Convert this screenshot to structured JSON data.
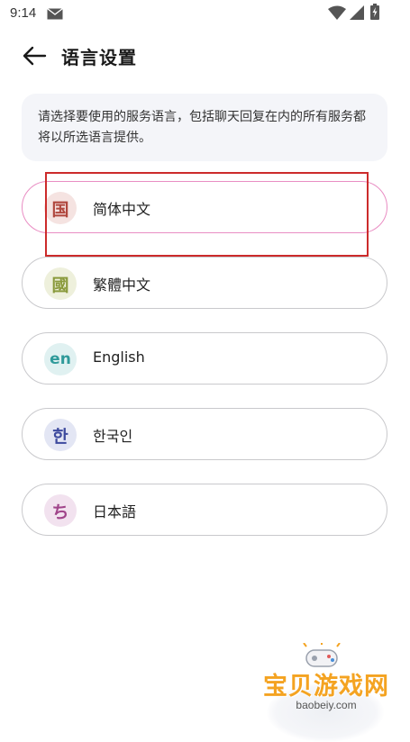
{
  "status_bar": {
    "time": "9:14",
    "icons": [
      "mail-icon",
      "wifi-icon",
      "signal-icon",
      "battery-charging-icon"
    ]
  },
  "header": {
    "back_icon": "arrow-left-icon",
    "title": "语言设置"
  },
  "notice": {
    "text": "请选择要使用的服务语言，包括聊天回复在内的所有服务都将以所选语言提供。"
  },
  "languages": [
    {
      "icon_text": "国",
      "label": "简体中文",
      "selected": true,
      "icon_bg": "#f5e3e1",
      "icon_color": "#b0473e"
    },
    {
      "icon_text": "國",
      "label": "繁體中文",
      "selected": false,
      "icon_bg": "#eef0dc",
      "icon_color": "#8a9a3c"
    },
    {
      "icon_text": "en",
      "label": "English",
      "selected": false,
      "icon_bg": "#e0f1f1",
      "icon_color": "#2f9a9a"
    },
    {
      "icon_text": "한",
      "label": "한국인",
      "selected": false,
      "icon_bg": "#e3e6f4",
      "icon_color": "#3d4a9e"
    },
    {
      "icon_text": "ち",
      "label": "日本語",
      "selected": false,
      "icon_bg": "#f2e2ef",
      "icon_color": "#a0448a"
    }
  ],
  "colors": {
    "selected_border": "#e98dc3",
    "item_border": "#c9c9cc",
    "highlight_box": "#cc2b2b",
    "notice_bg": "#f4f5f9"
  },
  "watermark": {
    "title": "宝贝游戏网",
    "url": "baobeiy.com"
  }
}
